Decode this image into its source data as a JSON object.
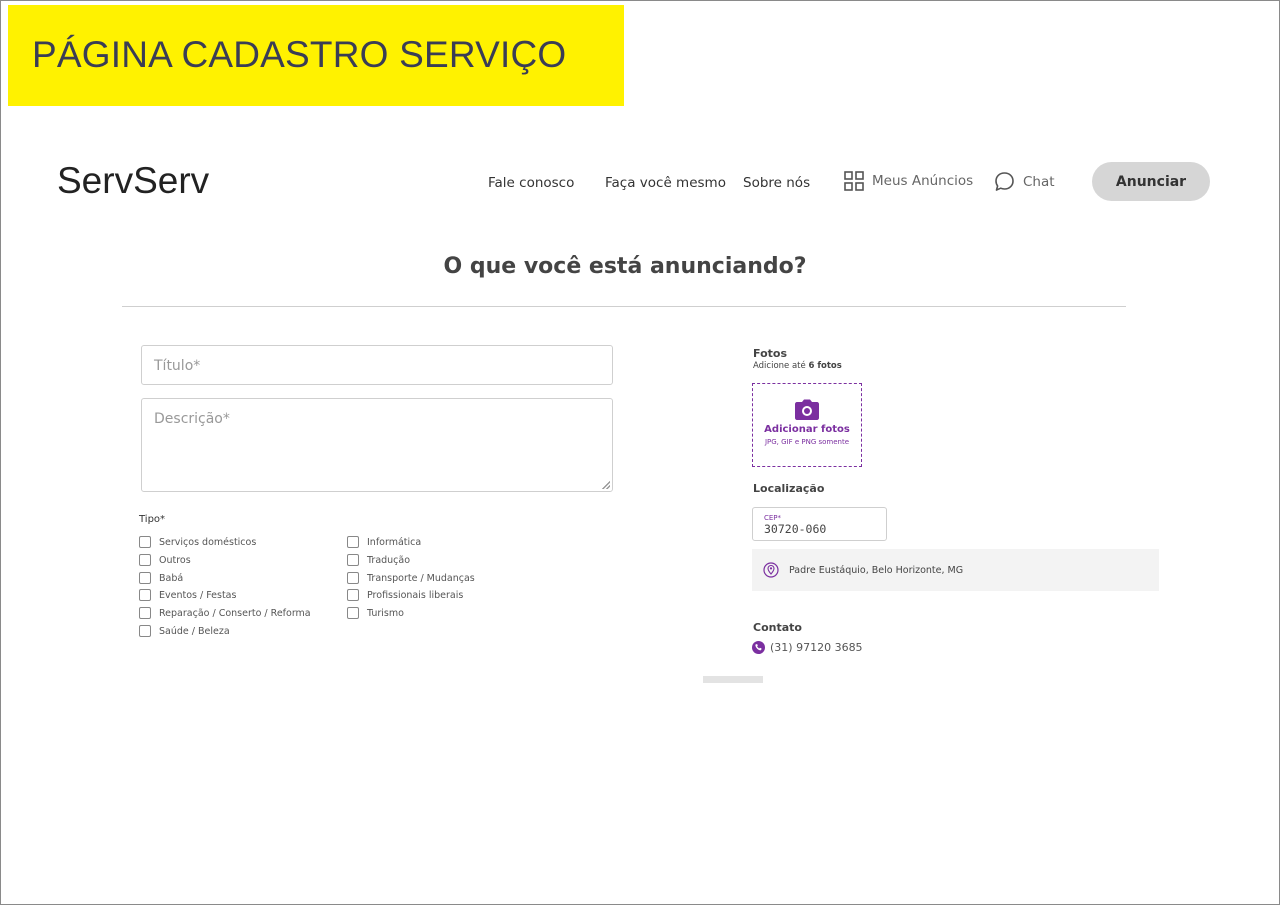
{
  "banner": {
    "title": "PÁGINA CADASTRO SERVIÇO",
    "color": "#fff200"
  },
  "header": {
    "logo": "ServServ",
    "nav": {
      "contact": "Fale conosco",
      "diy": "Faça você mesmo",
      "about": "Sobre nós",
      "my_ads": "Meus Anúncios",
      "chat": "Chat"
    },
    "cta": "Anunciar"
  },
  "page": {
    "title": "O que você está anunciando?"
  },
  "form": {
    "title_placeholder": "Título*",
    "description_placeholder": "Descrição*",
    "type_label": "Tipo*",
    "types_left": [
      "Serviços domésticos",
      "Outros",
      "Babá",
      "Eventos / Festas",
      "Reparação / Conserto / Reforma",
      "Saúde / Beleza"
    ],
    "types_right": [
      "Informática",
      "Tradução",
      "Transporte / Mudanças",
      "Profissionais liberais",
      "Turismo"
    ]
  },
  "photos": {
    "label": "Fotos",
    "note_prefix": "Adicione até ",
    "note_bold": "6 fotos",
    "add_label": "Adicionar fotos",
    "formats": "JPG, GIF e PNG somente",
    "accent": "#7b2fa0"
  },
  "location": {
    "label": "Localização",
    "cep_label": "CEP*",
    "cep_value": "30720-060",
    "address": "Padre Eustáquio, Belo Horizonte, MG"
  },
  "contact": {
    "label": "Contato",
    "phone": "(31) 97120 3685"
  },
  "icons": {
    "grid": "grid-icon",
    "chat": "chat-bubble-icon",
    "camera": "camera-icon",
    "pin": "map-pin-icon",
    "phone": "phone-icon"
  }
}
